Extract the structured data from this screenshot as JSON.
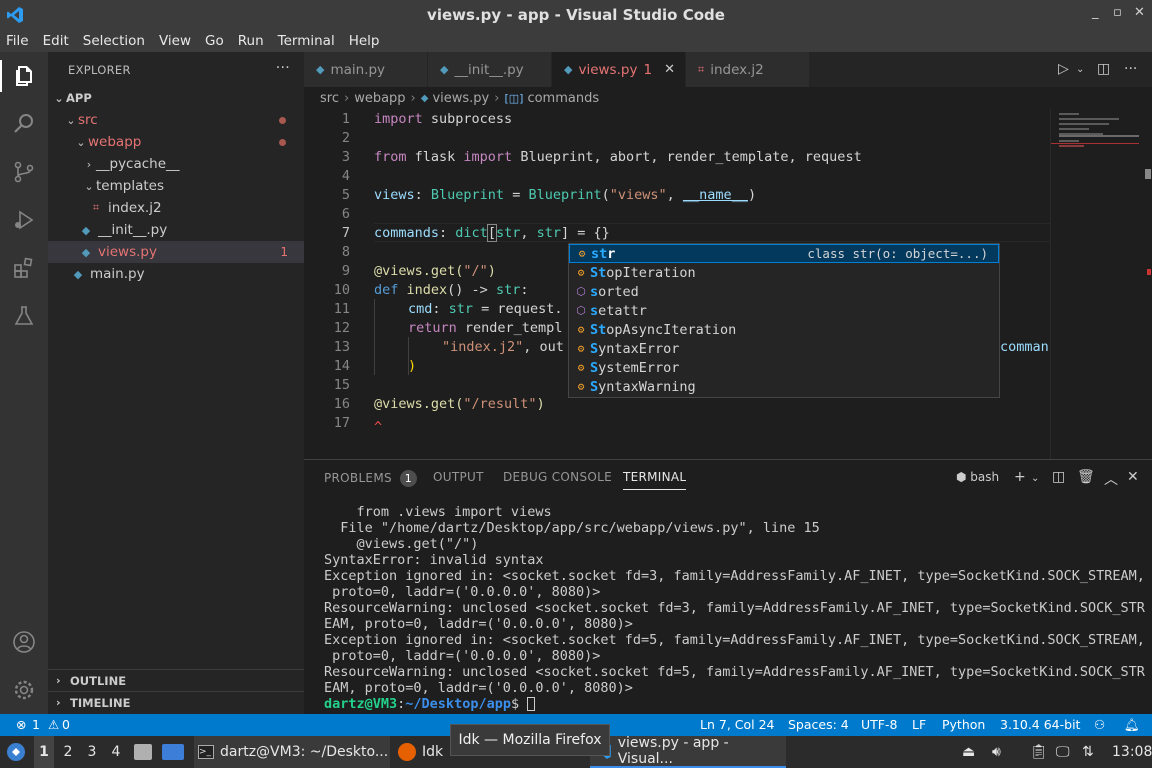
{
  "window": {
    "title": "views.py - app - Visual Studio Code",
    "controls": [
      "_",
      "▫",
      "✕"
    ]
  },
  "menu": [
    "File",
    "Edit",
    "Selection",
    "View",
    "Go",
    "Run",
    "Terminal",
    "Help"
  ],
  "sidebar": {
    "title": "EXPLORER",
    "root": "APP",
    "items": [
      {
        "label": "src",
        "kind": "folder",
        "open": true
      },
      {
        "label": "webapp",
        "kind": "folder",
        "open": true
      },
      {
        "label": "__pycache__",
        "kind": "folder",
        "open": false
      },
      {
        "label": "templates",
        "kind": "folder",
        "open": true
      },
      {
        "label": "index.j2",
        "kind": "j2"
      },
      {
        "label": "__init__.py",
        "kind": "py"
      },
      {
        "label": "views.py",
        "kind": "py",
        "badge": "1"
      },
      {
        "label": "main.py",
        "kind": "py"
      }
    ],
    "outline": "OUTLINE",
    "timeline": "TIMELINE"
  },
  "tabs": [
    {
      "label": "main.py"
    },
    {
      "label": "__init__.py"
    },
    {
      "label": "views.py",
      "badge": "1"
    },
    {
      "label": "index.j2"
    }
  ],
  "breadcrumb": [
    "src",
    "webapp",
    "views.py",
    "commands"
  ],
  "editor": {
    "line_numbers": [
      "1",
      "2",
      "3",
      "4",
      "5",
      "6",
      "7",
      "8",
      "9",
      "10",
      "11",
      "12",
      "13",
      "14",
      "15",
      "16",
      "17"
    ],
    "lines": {
      "l1_kw": "import",
      "l1_rest": " subprocess",
      "l3_kw1": "from",
      "l3_mod": " flask ",
      "l3_kw2": "import",
      "l3_rest": " Blueprint, abort, render_template, request",
      "l5_var": "views",
      "l5_a": ": ",
      "l5_ty": "Blueprint",
      "l5_b": " = ",
      "l5_fn": "Blueprint",
      "l5_c": "(",
      "l5_str": "\"views\"",
      "l5_d": ", ",
      "l5_name": "__name__",
      "l5_e": ")",
      "l7_var": "commands",
      "l7_a": ": ",
      "l7_ty": "dict",
      "l7_b": "[",
      "l7_t1": "str",
      "l7_c": ", ",
      "l7_t2": "str",
      "l7_d": "] = {}",
      "l9_dec": "@views.get(",
      "l9_str": "\"/\"",
      "l9_e": ")",
      "l10_kw": "def",
      "l10_fn": " index",
      "l10_a": "() -> ",
      "l10_ty": "str",
      "l10_b": ":",
      "l11_var": "cmd",
      "l11_a": ": ",
      "l11_ty": "str",
      "l11_b": " = request.",
      "l12_kw": "return",
      "l12_rest": " render_templ",
      "l13_str": "\"index.j2\"",
      "l13_a": ", out",
      "l13_tail": "comman",
      "l14_rest": ")",
      "l16_dec": "@views.get(",
      "l16_str": "\"/result\"",
      "l16_e": ")",
      "l17_rest": "^"
    }
  },
  "suggest": {
    "items": [
      {
        "pre": "",
        "hl": "st",
        "post": "r",
        "kind": "class",
        "detail": "class str(o: object=...)"
      },
      {
        "pre": "",
        "hl": "St",
        "post": "opIteration",
        "kind": "class"
      },
      {
        "pre": "",
        "hl": "s",
        "post": "orted",
        "kind": "func"
      },
      {
        "pre": "",
        "hl": "s",
        "post": "etattr",
        "kind": "func"
      },
      {
        "pre": "",
        "hl": "St",
        "post": "opAsyncIteration",
        "kind": "class"
      },
      {
        "pre": "",
        "hl": "S",
        "post": "yntaxError",
        "kind": "class"
      },
      {
        "pre": "",
        "hl": "S",
        "post": "ystemError",
        "kind": "class"
      },
      {
        "pre": "",
        "hl": "S",
        "post": "yntaxWarning",
        "kind": "class"
      }
    ]
  },
  "panel": {
    "tabs": [
      "PROBLEMS",
      "OUTPUT",
      "DEBUG CONSOLE",
      "TERMINAL"
    ],
    "problems_count": "1",
    "shell": "bash",
    "terminal_lines": [
      "    from .views import views",
      "  File \"/home/dartz/Desktop/app/src/webapp/views.py\", line 15",
      "    @views.get(\"/\")",
      "SyntaxError: invalid syntax",
      "Exception ignored in: <socket.socket fd=3, family=AddressFamily.AF_INET, type=SocketKind.SOCK_STREAM,",
      " proto=0, laddr=('0.0.0.0', 8080)>",
      "ResourceWarning: unclosed <socket.socket fd=3, family=AddressFamily.AF_INET, type=SocketKind.SOCK_STR",
      "EAM, proto=0, laddr=('0.0.0.0', 8080)>",
      "Exception ignored in: <socket.socket fd=5, family=AddressFamily.AF_INET, type=SocketKind.SOCK_STREAM,",
      " proto=0, laddr=('0.0.0.0', 8080)>",
      "ResourceWarning: unclosed <socket.socket fd=5, family=AddressFamily.AF_INET, type=SocketKind.SOCK_STR",
      "EAM, proto=0, laddr=('0.0.0.0', 8080)>"
    ],
    "prompt_user": "dartz@VM3",
    "prompt_sep": ":",
    "prompt_path": "~/Desktop/app",
    "prompt_end": "$ "
  },
  "status": {
    "errors": "1",
    "warnings": "0",
    "position": "Ln 7, Col 24",
    "spaces": "Spaces: 4",
    "encoding": "UTF-8",
    "eol": "LF",
    "language": "Python",
    "interpreter": "3.10.4 64-bit"
  },
  "taskbar": {
    "workspaces": [
      "1",
      "2",
      "3",
      "4"
    ],
    "terminal_task": "dartz@VM3: ~/Deskto...",
    "firefox_task": "Idk — Mozilla Firefox",
    "firefox_short": "Idk",
    "vscode_task": "views.py - app - Visual...",
    "clock": "13:08"
  },
  "tooltip": "Idk — Mozilla Firefox",
  "colors": {
    "accent": "#007acc",
    "error": "#e57373",
    "titlebar": "#3c3c3c"
  }
}
